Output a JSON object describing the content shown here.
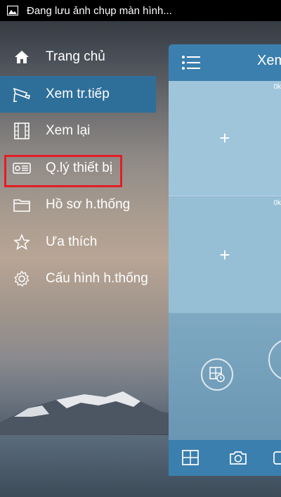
{
  "status_bar": {
    "text": "Đang lưu ảnh chụp màn hình..."
  },
  "menu": {
    "items": [
      {
        "label": "Trang chủ",
        "icon": "home-icon"
      },
      {
        "label": "Xem tr.tiếp",
        "icon": "cctv-camera-icon",
        "active": true
      },
      {
        "label": "Xem lại",
        "icon": "film-icon"
      },
      {
        "label": "Q.lý thiết bị",
        "icon": "device-card-icon",
        "highlighted": true
      },
      {
        "label": "Hồ sơ h.thống",
        "icon": "folder-icon"
      },
      {
        "label": "Ưa thích",
        "icon": "star-icon"
      },
      {
        "label": "Cấu hình h.thống",
        "icon": "gear-icon"
      }
    ]
  },
  "panel": {
    "title": "Xem",
    "cells": [
      {
        "speed": "0k",
        "add_symbol": "+"
      },
      {
        "speed": "0k",
        "add_symbol": "+"
      }
    ]
  },
  "colors": {
    "active_item": "#2e6f9a",
    "highlight_border": "#e41d25",
    "panel_header": "#3b7fae"
  }
}
